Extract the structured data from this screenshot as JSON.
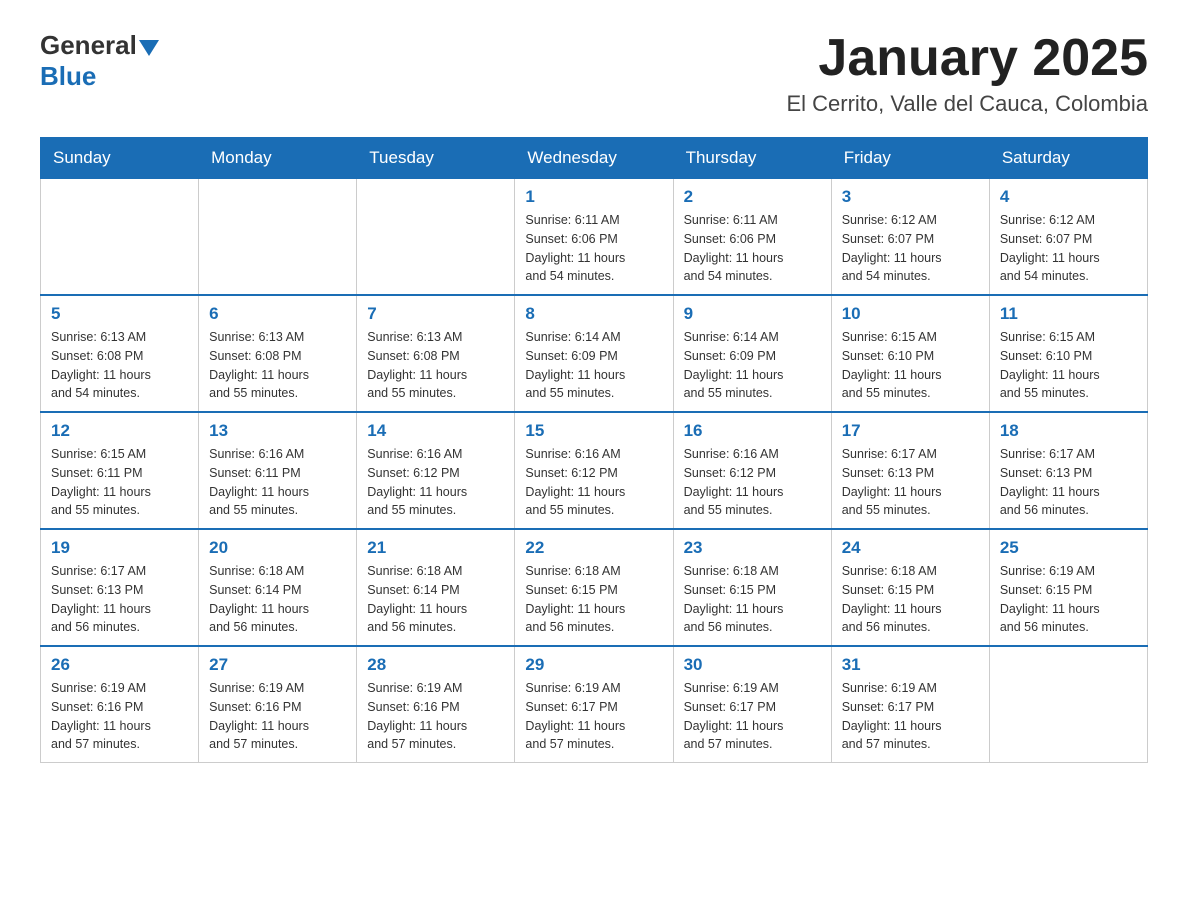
{
  "header": {
    "logo_general": "General",
    "logo_blue": "Blue",
    "title": "January 2025",
    "location": "El Cerrito, Valle del Cauca, Colombia"
  },
  "days_of_week": [
    "Sunday",
    "Monday",
    "Tuesday",
    "Wednesday",
    "Thursday",
    "Friday",
    "Saturday"
  ],
  "weeks": [
    [
      {
        "day": "",
        "info": ""
      },
      {
        "day": "",
        "info": ""
      },
      {
        "day": "",
        "info": ""
      },
      {
        "day": "1",
        "info": "Sunrise: 6:11 AM\nSunset: 6:06 PM\nDaylight: 11 hours\nand 54 minutes."
      },
      {
        "day": "2",
        "info": "Sunrise: 6:11 AM\nSunset: 6:06 PM\nDaylight: 11 hours\nand 54 minutes."
      },
      {
        "day": "3",
        "info": "Sunrise: 6:12 AM\nSunset: 6:07 PM\nDaylight: 11 hours\nand 54 minutes."
      },
      {
        "day": "4",
        "info": "Sunrise: 6:12 AM\nSunset: 6:07 PM\nDaylight: 11 hours\nand 54 minutes."
      }
    ],
    [
      {
        "day": "5",
        "info": "Sunrise: 6:13 AM\nSunset: 6:08 PM\nDaylight: 11 hours\nand 54 minutes."
      },
      {
        "day": "6",
        "info": "Sunrise: 6:13 AM\nSunset: 6:08 PM\nDaylight: 11 hours\nand 55 minutes."
      },
      {
        "day": "7",
        "info": "Sunrise: 6:13 AM\nSunset: 6:08 PM\nDaylight: 11 hours\nand 55 minutes."
      },
      {
        "day": "8",
        "info": "Sunrise: 6:14 AM\nSunset: 6:09 PM\nDaylight: 11 hours\nand 55 minutes."
      },
      {
        "day": "9",
        "info": "Sunrise: 6:14 AM\nSunset: 6:09 PM\nDaylight: 11 hours\nand 55 minutes."
      },
      {
        "day": "10",
        "info": "Sunrise: 6:15 AM\nSunset: 6:10 PM\nDaylight: 11 hours\nand 55 minutes."
      },
      {
        "day": "11",
        "info": "Sunrise: 6:15 AM\nSunset: 6:10 PM\nDaylight: 11 hours\nand 55 minutes."
      }
    ],
    [
      {
        "day": "12",
        "info": "Sunrise: 6:15 AM\nSunset: 6:11 PM\nDaylight: 11 hours\nand 55 minutes."
      },
      {
        "day": "13",
        "info": "Sunrise: 6:16 AM\nSunset: 6:11 PM\nDaylight: 11 hours\nand 55 minutes."
      },
      {
        "day": "14",
        "info": "Sunrise: 6:16 AM\nSunset: 6:12 PM\nDaylight: 11 hours\nand 55 minutes."
      },
      {
        "day": "15",
        "info": "Sunrise: 6:16 AM\nSunset: 6:12 PM\nDaylight: 11 hours\nand 55 minutes."
      },
      {
        "day": "16",
        "info": "Sunrise: 6:16 AM\nSunset: 6:12 PM\nDaylight: 11 hours\nand 55 minutes."
      },
      {
        "day": "17",
        "info": "Sunrise: 6:17 AM\nSunset: 6:13 PM\nDaylight: 11 hours\nand 55 minutes."
      },
      {
        "day": "18",
        "info": "Sunrise: 6:17 AM\nSunset: 6:13 PM\nDaylight: 11 hours\nand 56 minutes."
      }
    ],
    [
      {
        "day": "19",
        "info": "Sunrise: 6:17 AM\nSunset: 6:13 PM\nDaylight: 11 hours\nand 56 minutes."
      },
      {
        "day": "20",
        "info": "Sunrise: 6:18 AM\nSunset: 6:14 PM\nDaylight: 11 hours\nand 56 minutes."
      },
      {
        "day": "21",
        "info": "Sunrise: 6:18 AM\nSunset: 6:14 PM\nDaylight: 11 hours\nand 56 minutes."
      },
      {
        "day": "22",
        "info": "Sunrise: 6:18 AM\nSunset: 6:15 PM\nDaylight: 11 hours\nand 56 minutes."
      },
      {
        "day": "23",
        "info": "Sunrise: 6:18 AM\nSunset: 6:15 PM\nDaylight: 11 hours\nand 56 minutes."
      },
      {
        "day": "24",
        "info": "Sunrise: 6:18 AM\nSunset: 6:15 PM\nDaylight: 11 hours\nand 56 minutes."
      },
      {
        "day": "25",
        "info": "Sunrise: 6:19 AM\nSunset: 6:15 PM\nDaylight: 11 hours\nand 56 minutes."
      }
    ],
    [
      {
        "day": "26",
        "info": "Sunrise: 6:19 AM\nSunset: 6:16 PM\nDaylight: 11 hours\nand 57 minutes."
      },
      {
        "day": "27",
        "info": "Sunrise: 6:19 AM\nSunset: 6:16 PM\nDaylight: 11 hours\nand 57 minutes."
      },
      {
        "day": "28",
        "info": "Sunrise: 6:19 AM\nSunset: 6:16 PM\nDaylight: 11 hours\nand 57 minutes."
      },
      {
        "day": "29",
        "info": "Sunrise: 6:19 AM\nSunset: 6:17 PM\nDaylight: 11 hours\nand 57 minutes."
      },
      {
        "day": "30",
        "info": "Sunrise: 6:19 AM\nSunset: 6:17 PM\nDaylight: 11 hours\nand 57 minutes."
      },
      {
        "day": "31",
        "info": "Sunrise: 6:19 AM\nSunset: 6:17 PM\nDaylight: 11 hours\nand 57 minutes."
      },
      {
        "day": "",
        "info": ""
      }
    ]
  ]
}
